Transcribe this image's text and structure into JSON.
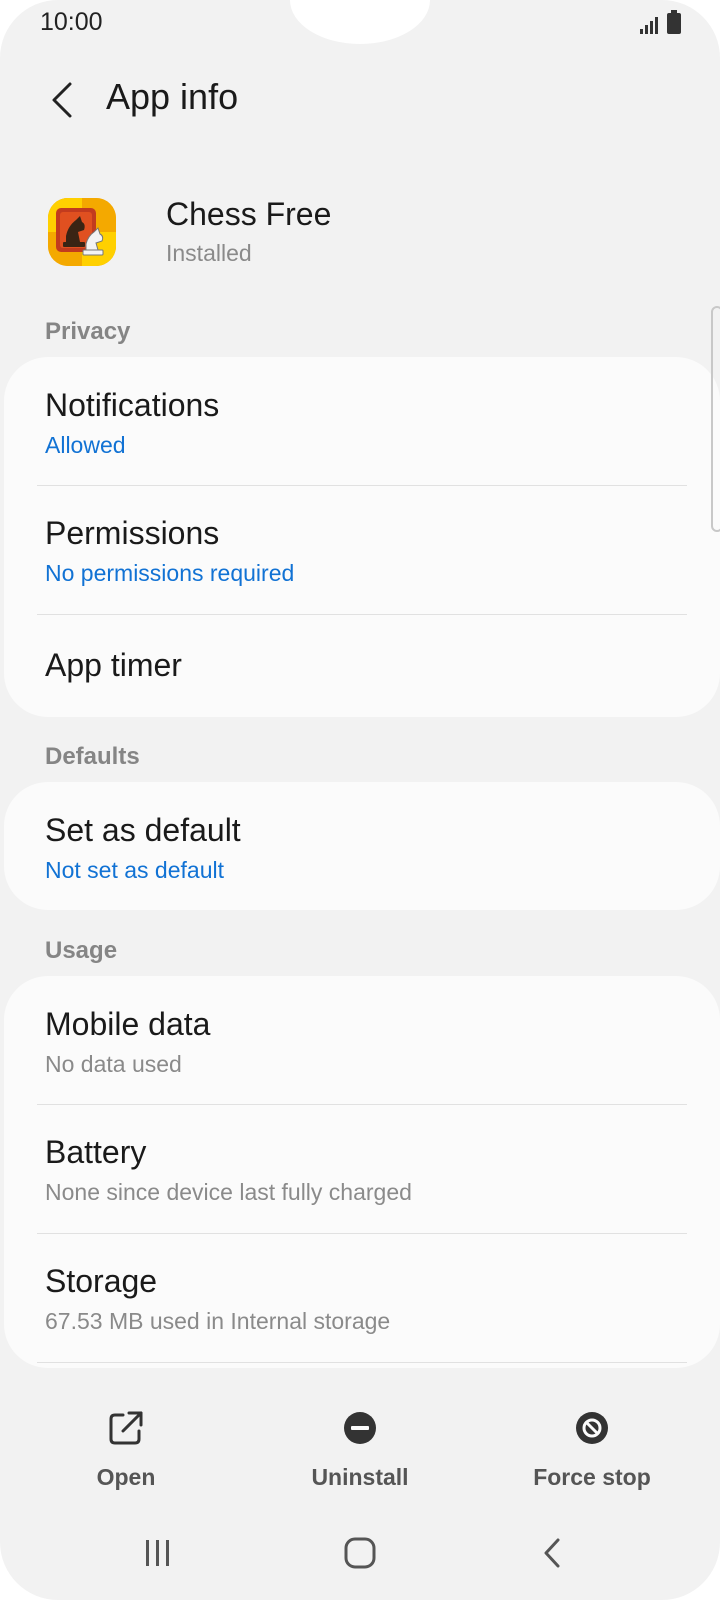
{
  "status_bar": {
    "time": "10:00",
    "signal_icon": "signal-icon",
    "battery_icon": "battery-icon"
  },
  "app_bar": {
    "back_icon": "chevron-left-icon",
    "title": "App info"
  },
  "app": {
    "name": "Chess Free",
    "status": "Installed",
    "icon": "chess-knight-icon"
  },
  "sections": {
    "privacy": {
      "header": "Privacy",
      "notifications": {
        "title": "Notifications",
        "value": "Allowed"
      },
      "permissions": {
        "title": "Permissions",
        "value": "No permissions required"
      },
      "app_timer": {
        "title": "App timer"
      }
    },
    "defaults": {
      "header": "Defaults",
      "set_as_default": {
        "title": "Set as default",
        "value": "Not set as default"
      }
    },
    "usage": {
      "header": "Usage",
      "mobile_data": {
        "title": "Mobile data",
        "value": "No data used"
      },
      "battery": {
        "title": "Battery",
        "value": "None since device last fully charged"
      },
      "storage": {
        "title": "Storage",
        "value": "67.53 MB used in Internal storage"
      }
    }
  },
  "actions": {
    "open": {
      "label": "Open",
      "icon": "open-external-icon"
    },
    "uninstall": {
      "label": "Uninstall",
      "icon": "minus-circle-icon"
    },
    "force_stop": {
      "label": "Force stop",
      "icon": "block-circle-icon"
    }
  },
  "nav_bar": {
    "recents_icon": "recents-icon",
    "home_icon": "home-icon",
    "back_icon": "back-icon"
  },
  "colors": {
    "accent": "#1172d4",
    "background": "#f2f2f2",
    "card": "#fbfbfb"
  }
}
